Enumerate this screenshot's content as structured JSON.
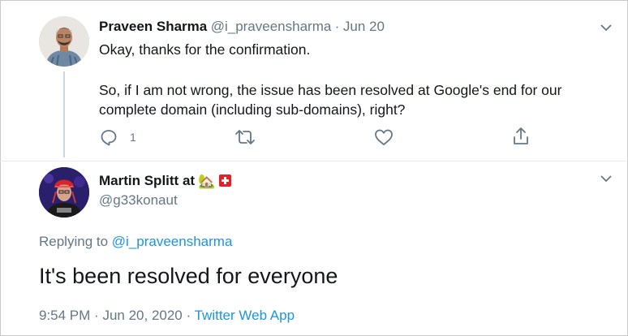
{
  "reply_tweet": {
    "author_name": "Praveen Sharma",
    "handle": "@i_praveensharma",
    "separator": "·",
    "date": "Jun 20",
    "text_line1": "Okay, thanks for the confirmation.",
    "text_para2_line1": "So, if I am not wrong, the issue has been resolved at Google's end for our",
    "text_para2_line2": "complete domain (including sub-domains), right?",
    "reply_count": "1",
    "icons": [
      "reply-icon",
      "retweet-icon",
      "like-icon",
      "share-icon",
      "chevron-down-icon"
    ]
  },
  "main_tweet": {
    "author_name": "Martin Splitt at",
    "name_emojis": [
      "house-emoji",
      "swiss-flag-emoji"
    ],
    "handle": "@g33konaut",
    "replying_prefix": "Replying to",
    "replying_handle": "@i_praveensharma",
    "text": "It's been resolved for everyone",
    "time": "9:54 PM",
    "separator": "·",
    "date": "Jun 20, 2020",
    "source": "Twitter Web App"
  },
  "colors": {
    "link": "#1b95e0",
    "secondary_text": "#657786",
    "primary_text": "#14171a",
    "thread_line": "#ccd6dd"
  }
}
